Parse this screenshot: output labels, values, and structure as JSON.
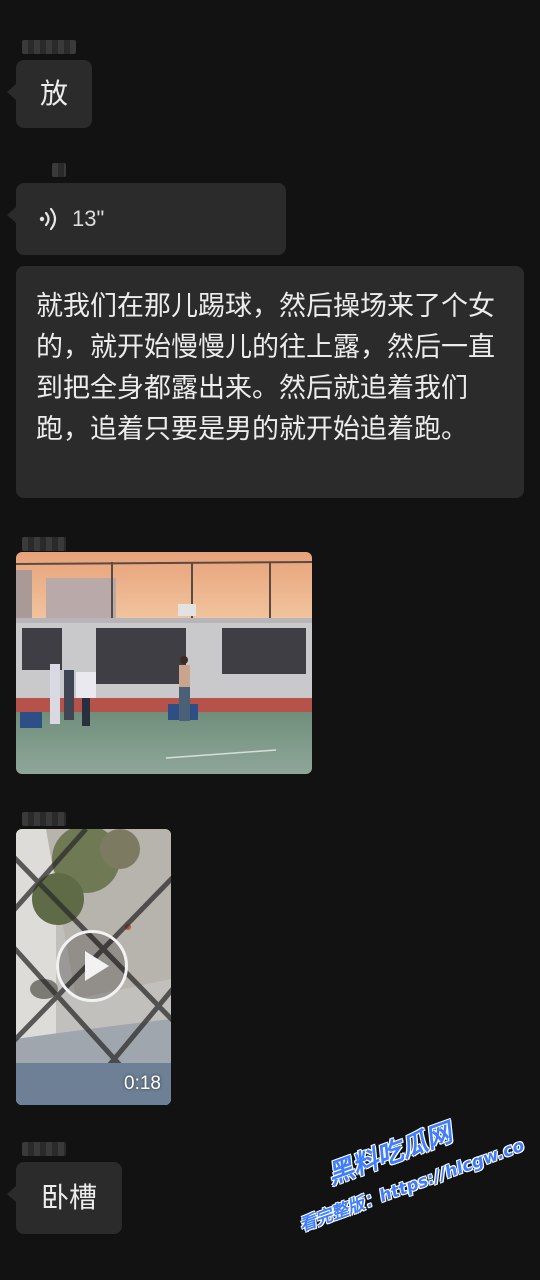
{
  "messages": [
    {
      "type": "text",
      "text": "放"
    },
    {
      "type": "voice",
      "duration": "13\""
    },
    {
      "type": "text",
      "text": "就我们在那儿踢球，然后操场来了个女的，就开始慢慢儿的往上露，然后一直到把全身都露出来。然后就追着我们跑，追着只要是男的就开始追着跑。"
    },
    {
      "type": "image"
    },
    {
      "type": "video",
      "duration": "0:18"
    },
    {
      "type": "text",
      "text": "卧槽"
    }
  ],
  "watermark": {
    "brand": "黑料吃瓜网",
    "url": "看完整版：https://hlcgw.co"
  },
  "colors": {
    "background": "#121212",
    "bubble": "#2b2b2b",
    "watermark": "#3f7fff"
  }
}
